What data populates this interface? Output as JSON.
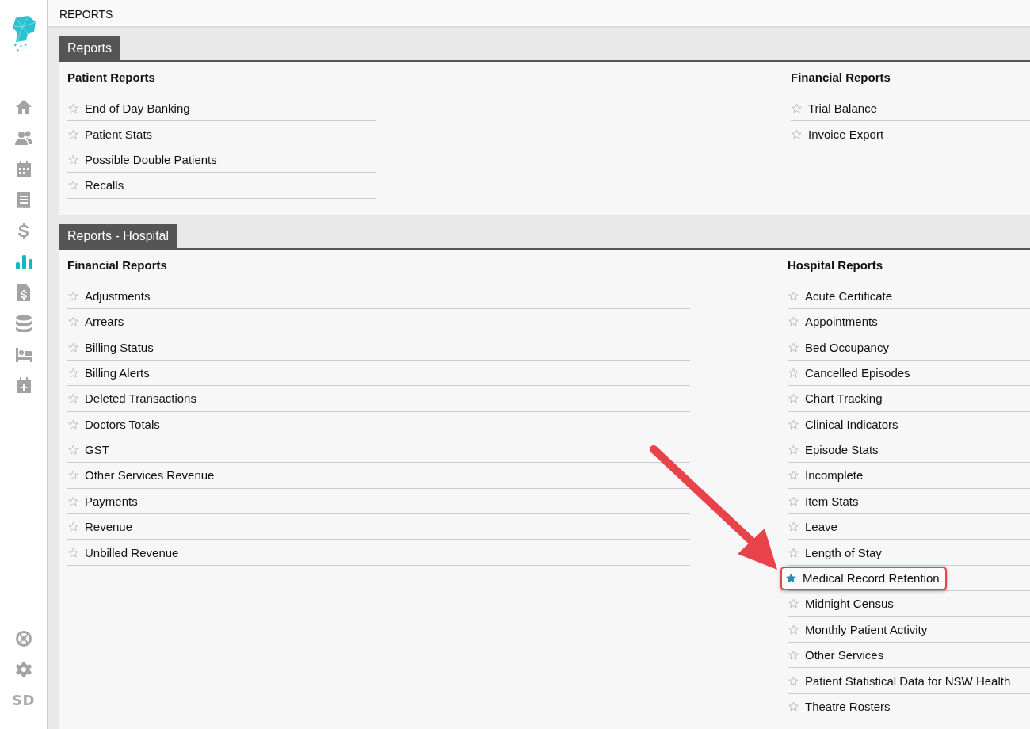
{
  "sidebar": {
    "items": [
      {
        "kind": "home",
        "selected": false
      },
      {
        "kind": "people",
        "selected": false
      },
      {
        "kind": "calendar",
        "selected": false
      },
      {
        "kind": "receipt",
        "selected": false
      },
      {
        "kind": "dollar",
        "selected": false
      },
      {
        "kind": "chart",
        "selected": true
      },
      {
        "kind": "invoice",
        "selected": false
      },
      {
        "kind": "database",
        "selected": false
      },
      {
        "kind": "bed",
        "selected": false
      },
      {
        "kind": "calendar-plus",
        "selected": false
      }
    ],
    "bottom_items": [
      {
        "kind": "help"
      },
      {
        "kind": "settings"
      }
    ],
    "user_initials": "SD"
  },
  "header": {
    "title": "REPORTS"
  },
  "panels": [
    {
      "title": "Reports",
      "columns": [
        {
          "heading": "Patient Reports",
          "items": [
            {
              "label": "End of Day Banking",
              "favorite": false,
              "highlighted": false
            },
            {
              "label": "Patient Stats",
              "favorite": false,
              "highlighted": false
            },
            {
              "label": "Possible Double Patients",
              "favorite": false,
              "highlighted": false
            },
            {
              "label": "Recalls",
              "favorite": false,
              "highlighted": false
            }
          ]
        },
        {
          "heading": "Financial Reports",
          "items": [
            {
              "label": "Trial Balance",
              "favorite": false,
              "highlighted": false
            },
            {
              "label": "Invoice Export",
              "favorite": false,
              "highlighted": false
            }
          ]
        }
      ]
    },
    {
      "title": "Reports - Hospital",
      "columns": [
        {
          "heading": "Financial Reports",
          "items": [
            {
              "label": "Adjustments",
              "favorite": false,
              "highlighted": false
            },
            {
              "label": "Arrears",
              "favorite": false,
              "highlighted": false
            },
            {
              "label": "Billing Status",
              "favorite": false,
              "highlighted": false
            },
            {
              "label": "Billing Alerts",
              "favorite": false,
              "highlighted": false
            },
            {
              "label": "Deleted Transactions",
              "favorite": false,
              "highlighted": false
            },
            {
              "label": "Doctors Totals",
              "favorite": false,
              "highlighted": false
            },
            {
              "label": "GST",
              "favorite": false,
              "highlighted": false
            },
            {
              "label": "Other Services Revenue",
              "favorite": false,
              "highlighted": false
            },
            {
              "label": "Payments",
              "favorite": false,
              "highlighted": false
            },
            {
              "label": "Revenue",
              "favorite": false,
              "highlighted": false
            },
            {
              "label": "Unbilled Revenue",
              "favorite": false,
              "highlighted": false
            }
          ]
        },
        {
          "heading": "Hospital Reports",
          "items": [
            {
              "label": "Acute Certificate",
              "favorite": false,
              "highlighted": false
            },
            {
              "label": "Appointments",
              "favorite": false,
              "highlighted": false
            },
            {
              "label": "Bed Occupancy",
              "favorite": false,
              "highlighted": false
            },
            {
              "label": "Cancelled Episodes",
              "favorite": false,
              "highlighted": false
            },
            {
              "label": "Chart Tracking",
              "favorite": false,
              "highlighted": false
            },
            {
              "label": "Clinical Indicators",
              "favorite": false,
              "highlighted": false
            },
            {
              "label": "Episode Stats",
              "favorite": false,
              "highlighted": false
            },
            {
              "label": "Incomplete",
              "favorite": false,
              "highlighted": false
            },
            {
              "label": "Item Stats",
              "favorite": false,
              "highlighted": false
            },
            {
              "label": "Leave",
              "favorite": false,
              "highlighted": false
            },
            {
              "label": "Length of Stay",
              "favorite": false,
              "highlighted": false
            },
            {
              "label": "Medical Record Retention",
              "favorite": true,
              "highlighted": true
            },
            {
              "label": "Midnight Census",
              "favorite": false,
              "highlighted": false
            },
            {
              "label": "Monthly Patient Activity",
              "favorite": false,
              "highlighted": false
            },
            {
              "label": "Other Services",
              "favorite": false,
              "highlighted": false
            },
            {
              "label": "Patient Statistical Data for NSW Health",
              "favorite": false,
              "highlighted": false
            },
            {
              "label": "Theatre Rosters",
              "favorite": false,
              "highlighted": false
            }
          ]
        }
      ]
    }
  ]
}
